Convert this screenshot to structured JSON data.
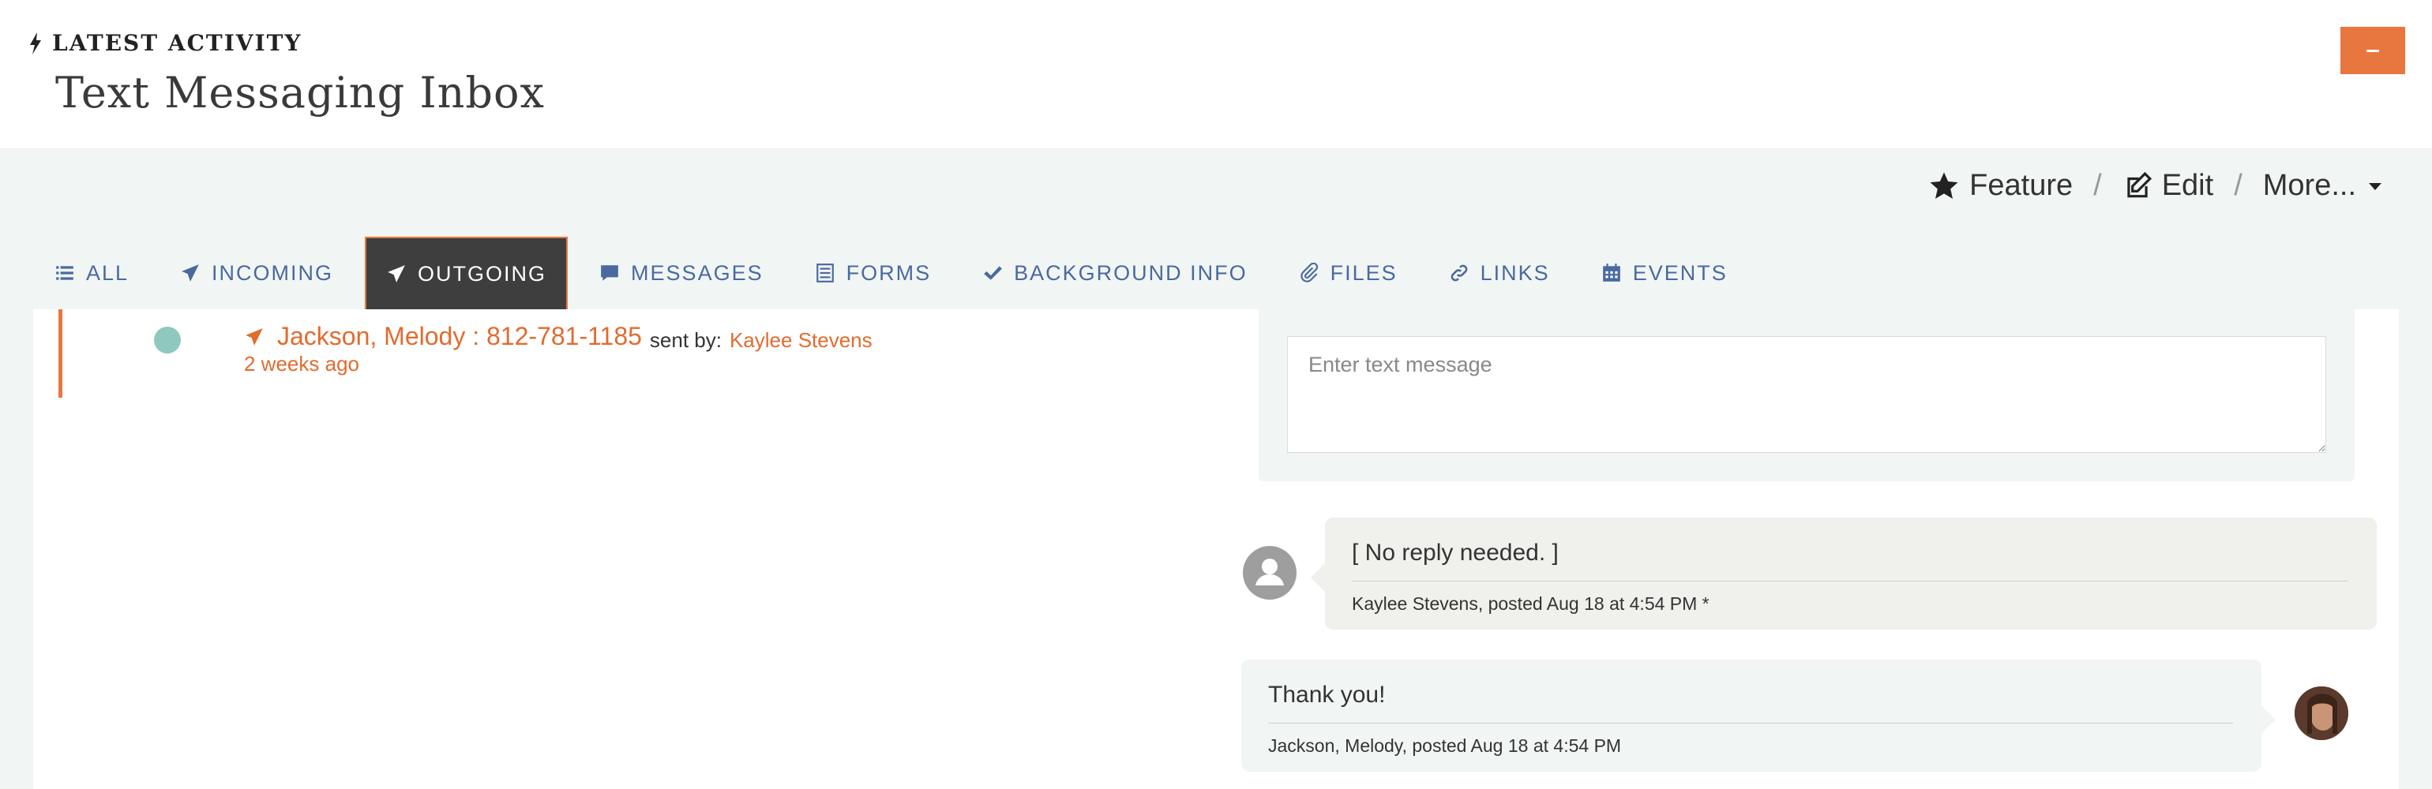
{
  "header": {
    "eyebrow": "LATEST ACTIVITY",
    "title": "Text Messaging Inbox",
    "collapse_icon": "minus-icon",
    "accent_color": "#e8773f"
  },
  "actions": {
    "feature_label": "Feature",
    "edit_label": "Edit",
    "more_label": "More...",
    "separator": "/"
  },
  "tabs": [
    {
      "label": "ALL",
      "icon": "list-icon"
    },
    {
      "label": "INCOMING",
      "icon": "paper-plane-icon"
    },
    {
      "label": "OUTGOING",
      "icon": "paper-plane-icon",
      "active": true
    },
    {
      "label": "MESSAGES",
      "icon": "comment-icon"
    },
    {
      "label": "FORMS",
      "icon": "form-icon"
    },
    {
      "label": "BACKGROUND INFO",
      "icon": "check-icon"
    },
    {
      "label": "FILES",
      "icon": "paperclip-icon"
    },
    {
      "label": "LINKS",
      "icon": "link-icon"
    },
    {
      "label": "EVENTS",
      "icon": "calendar-icon"
    }
  ],
  "feed": {
    "contact": "Jackson, Melody : 812-781-1185",
    "sent_by_label": "sent by:",
    "sender": "Kaylee Stevens",
    "time": "2 weeks ago"
  },
  "compose": {
    "placeholder": "Enter text message"
  },
  "messages": [
    {
      "text": "[ No reply needed. ]",
      "meta": "Kaylee Stevens, posted Aug 18 at 4:54 PM *"
    },
    {
      "text": "Thank you!",
      "meta": "Jackson, Melody, posted Aug 18 at 4:54 PM"
    }
  ]
}
